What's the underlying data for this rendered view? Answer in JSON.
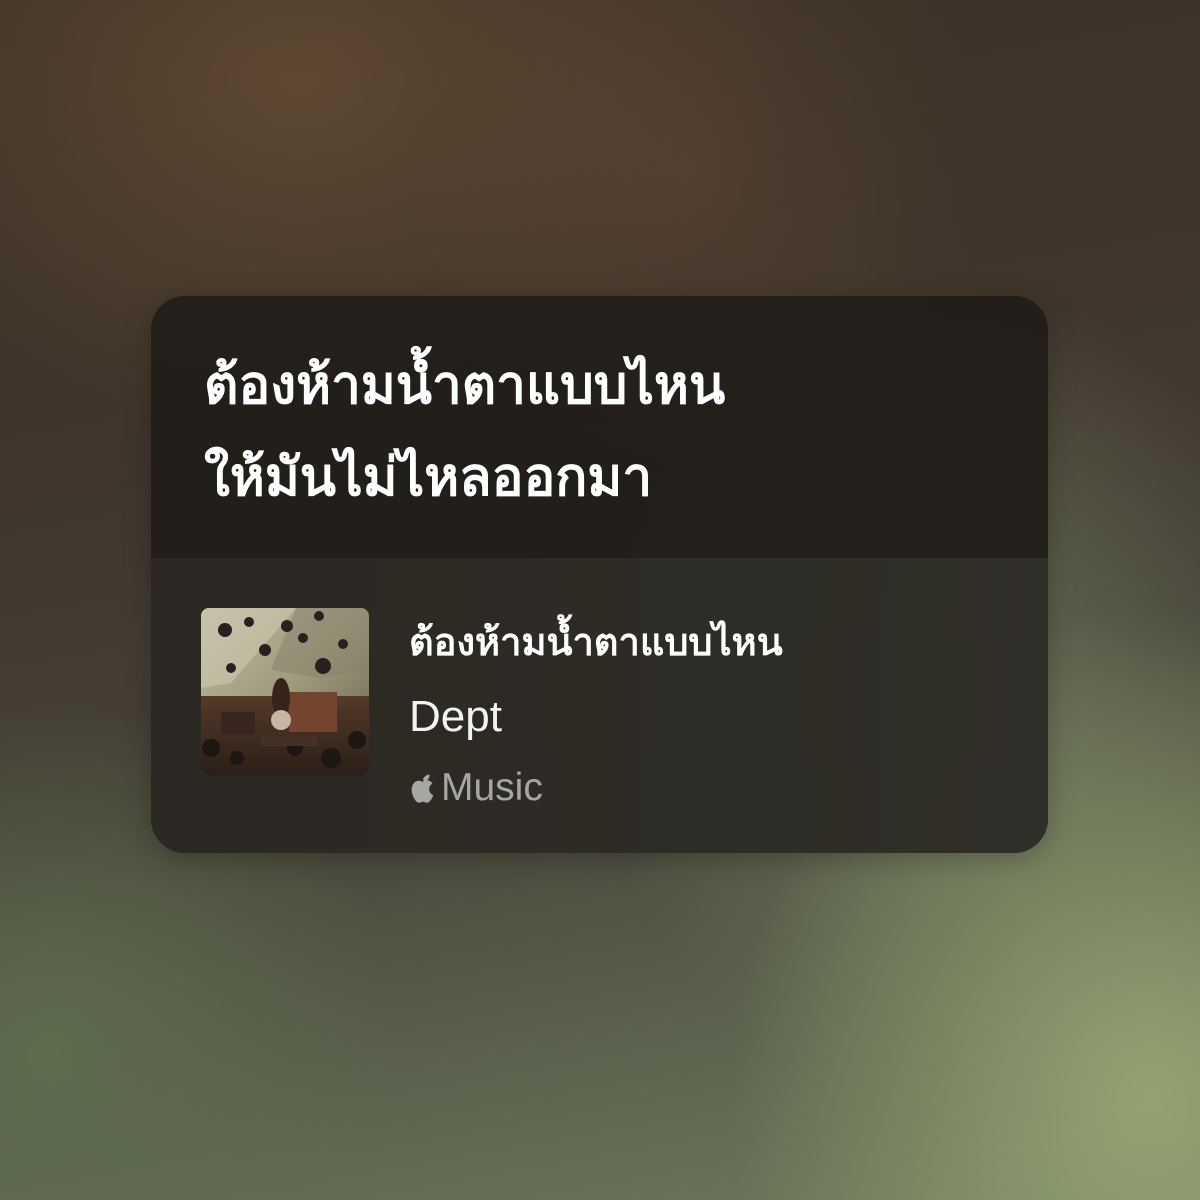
{
  "share_card": {
    "lyric": "ต้องห้ามน้ำตาแบบไหน\nให้มันไม่ไหลออกมา",
    "song": {
      "title": "ต้องห้ามน้ำตาแบบไหน",
      "artist": "Dept",
      "artwork_icon": "album-artwork-image"
    },
    "brand": {
      "icon": "apple-logo-icon",
      "label": "Music"
    }
  }
}
